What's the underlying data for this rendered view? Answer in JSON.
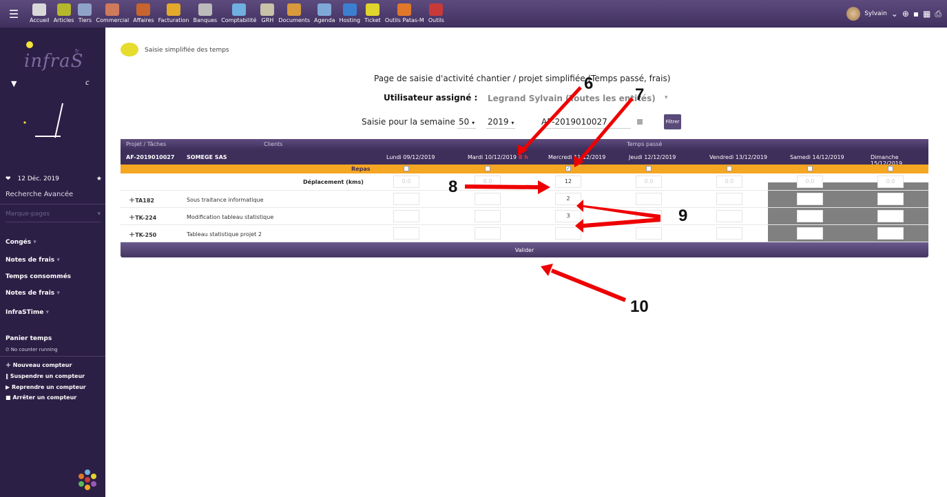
{
  "topbar": {
    "menu": [
      {
        "label": "Accueil",
        "icon": "home-icon",
        "color": "#d9d9d9"
      },
      {
        "label": "Articles",
        "icon": "articles-icon",
        "color": "#b5b82a"
      },
      {
        "label": "Tiers",
        "icon": "tiers-icon",
        "color": "#8fa3c8"
      },
      {
        "label": "Commercial",
        "icon": "commercial-icon",
        "color": "#d07a5c"
      },
      {
        "label": "Affaires",
        "icon": "affaires-icon",
        "color": "#c8642d"
      },
      {
        "label": "Facturation",
        "icon": "facturation-icon",
        "color": "#e3a92a"
      },
      {
        "label": "Banques",
        "icon": "banques-icon",
        "color": "#bbbbbb"
      },
      {
        "label": "Comptabilité",
        "icon": "comptabilite-icon",
        "color": "#6fb0e0"
      },
      {
        "label": "GRH",
        "icon": "grh-icon",
        "color": "#c9c2a8"
      },
      {
        "label": "Documents",
        "icon": "documents-icon",
        "color": "#d89a3c"
      },
      {
        "label": "Agenda",
        "icon": "agenda-icon",
        "color": "#7ea9d7"
      },
      {
        "label": "Hosting",
        "icon": "hosting-icon",
        "color": "#3c7fd0"
      },
      {
        "label": "Ticket",
        "icon": "ticket-icon",
        "color": "#e0d52c"
      },
      {
        "label": "Outils Patas-M",
        "icon": "outils-patas-icon",
        "color": "#e0782a"
      },
      {
        "label": "Outils",
        "icon": "outils-icon",
        "color": "#c83a3a"
      }
    ],
    "user_name": "Sylvain"
  },
  "sidebar": {
    "logo_text": "infraS",
    "logo_suffix": "fr",
    "clock_letter": "c",
    "date": "12 Déc. 2019",
    "advanced_search": "Recherche Avancée",
    "bookmarks": "Marque-pages",
    "menus": [
      "Congés",
      "Notes de frais",
      "Temps consommés",
      "Notes de frais",
      "InfraSTime"
    ],
    "basket_title": "Panier temps",
    "no_counter": "No counter running",
    "counter_actions": [
      "Nouveau compteur",
      "Suspendre un compteur",
      "Reprendre un compteur",
      "Arrêter un compteur"
    ]
  },
  "main": {
    "breadcrumb": "Saisie simplifiée des temps",
    "heading": "Page de saisie d'activité chantier / projet simplifiée (Temps passé, frais)",
    "assigned_label": "Utilisateur assigné :",
    "assigned_value": "Legrand Sylvain (Toutes les entités)",
    "week_label": "Saisie pour la semaine",
    "week": "50",
    "year": "2019",
    "reference": "AF-2019010027",
    "filter_label": "Filtrer",
    "validate_label": "Valider"
  },
  "table": {
    "col_project": "Projet / Tâches",
    "col_clients": "Clients",
    "col_time": "Temps passé",
    "project_ref": "AF-2019010027",
    "client": "SOMEGE SAS",
    "days": [
      "Lundi 09/12/2019",
      "Mardi 10/12/2019",
      "Mercredi 11/12/2019",
      "Jeudi 12/12/2019",
      "Vendredi 13/12/2019",
      "Samedi 14/12/2019",
      "Dimanche 15/12/2019"
    ],
    "mardi_badge": "8 h",
    "repas_label": "Repas",
    "repas_checked": [
      false,
      false,
      true,
      false,
      false,
      false,
      false
    ],
    "deplacement_label": "Déplacement (kms)",
    "deplacement": [
      "0.0",
      "0.0",
      "12",
      "0.0",
      "0.0",
      "0.0",
      "0.0"
    ],
    "tasks": [
      {
        "code": "TA182",
        "name": "Sous traitance informatique",
        "values": [
          "",
          "",
          "2",
          "",
          "",
          "",
          ""
        ]
      },
      {
        "code": "TK-224",
        "name": "Modification tableau statistique",
        "values": [
          "",
          "",
          "3",
          "",
          "",
          "",
          ""
        ]
      },
      {
        "code": "TK-250",
        "name": "Tableau statistique projet 2",
        "values": [
          "",
          "",
          "",
          "",
          "",
          "",
          ""
        ]
      }
    ]
  },
  "annotations": [
    "6",
    "7",
    "8",
    "9",
    "10"
  ],
  "colors": {
    "accent": "#3d2e5a",
    "repas": "#f5a623",
    "arrow": "#ee0000"
  }
}
